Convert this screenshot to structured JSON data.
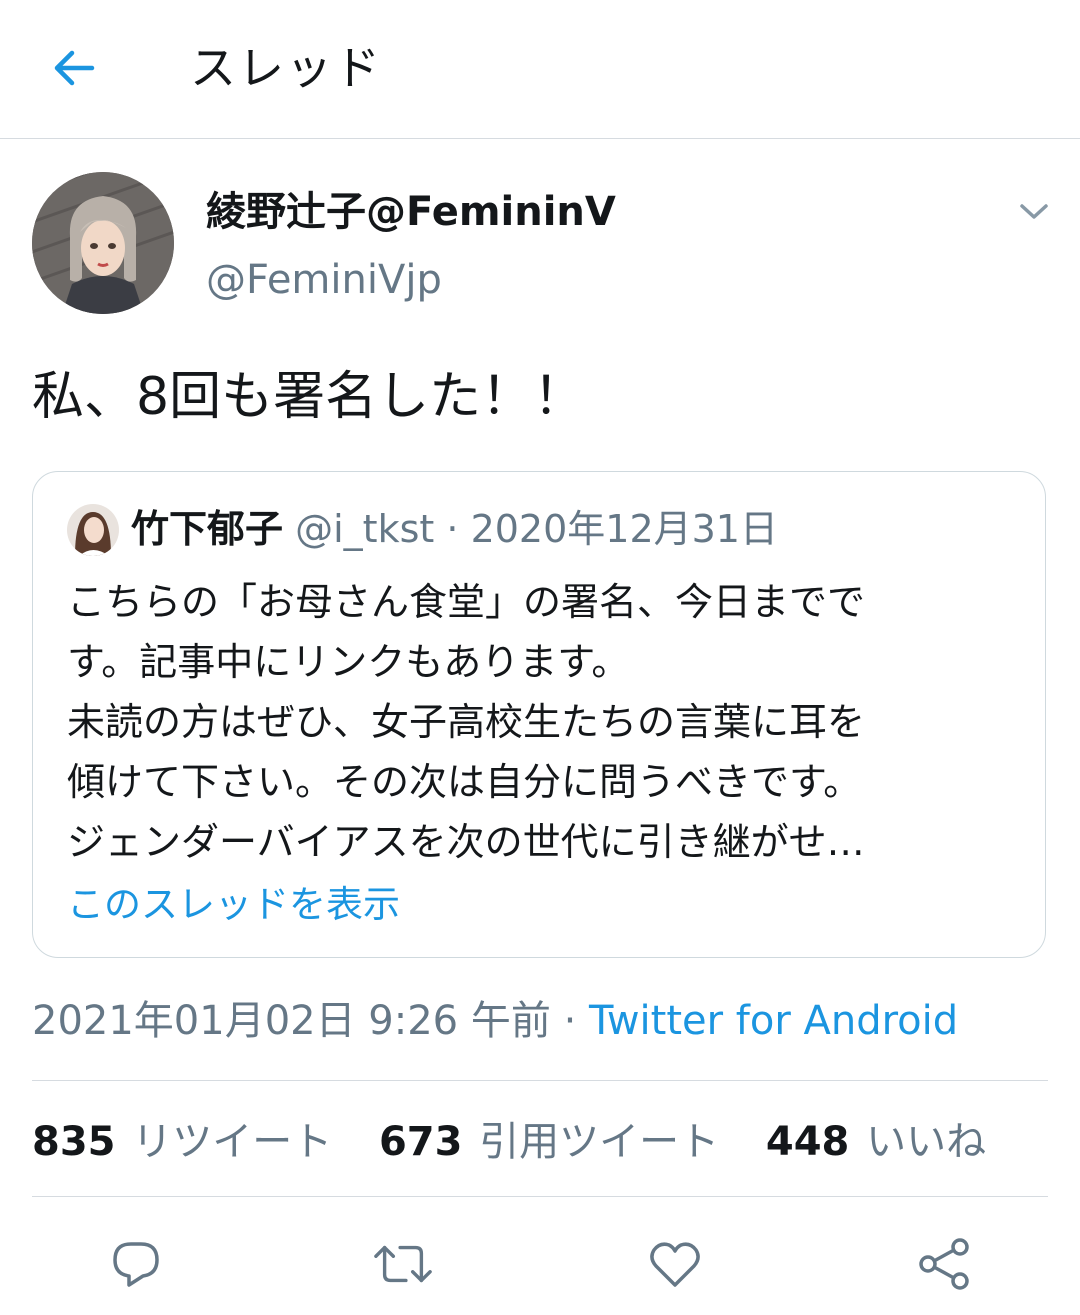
{
  "header": {
    "title": "スレッド"
  },
  "tweet": {
    "display_name": "綾野辻子@FemininV",
    "handle": "@FeminiVjp",
    "text": "私、8回も署名した！！",
    "timestamp": "2021年01月02日 9:26 午前",
    "separator": "·",
    "source": "Twitter for Android"
  },
  "quote": {
    "name": "竹下郁子",
    "handle": "@i_tkst",
    "separator": "·",
    "date": "2020年12月31日",
    "lines": [
      "こちらの「お母さん食堂」の署名、今日までで",
      "す。記事中にリンクもあります。",
      "未読の方はぜひ、女子高校生たちの言葉に耳を",
      "傾けて下さい。その次は自分に問うべきです。",
      "ジェンダーバイアスを次の世代に引き継がせ…"
    ],
    "show_thread": "このスレッドを表示"
  },
  "stats": {
    "retweets_count": "835",
    "retweets_label": "リツイート",
    "quotes_count": "673",
    "quotes_label": "引用ツイート",
    "likes_count": "448",
    "likes_label": "いいね"
  },
  "colors": {
    "accent": "#1b95e0",
    "muted_text": "#657786",
    "divider": "#d6dbe0"
  },
  "icons": {
    "back": "arrow-left-icon",
    "caret": "chevron-down-icon",
    "reply": "reply-icon",
    "retweet": "retweet-icon",
    "like": "heart-icon",
    "share": "share-icon"
  }
}
